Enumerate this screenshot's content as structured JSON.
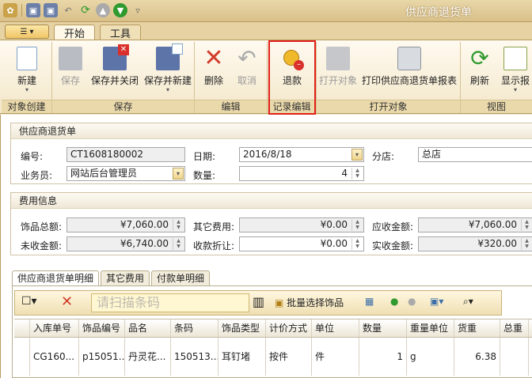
{
  "window": {
    "title": "供应商退货单"
  },
  "ribbon_tabs": [
    {
      "label": "开始"
    },
    {
      "label": "工具"
    }
  ],
  "ribbon": {
    "groups": {
      "create": "对象创建",
      "save": "保存",
      "edit": "编辑",
      "record_edit": "记录编辑",
      "open": "打开对象",
      "view": "视图"
    },
    "buttons": {
      "new": "新建",
      "save": "保存",
      "save_close": "保存并关闭",
      "save_new": "保存并新建",
      "delete": "删除",
      "cancel": "取消",
      "refund": "退款",
      "open_object": "打开对象",
      "print": "打印供应商退货单报表",
      "refresh": "刷新",
      "show_report": "显示报"
    }
  },
  "header_panel": {
    "title": "供应商退货单",
    "number_label": "编号:",
    "number_value": "CT1608180002",
    "date_label": "日期:",
    "date_value": "2016/8/18",
    "branch_label": "分店:",
    "branch_value": "总店",
    "salesman_label": "业务员:",
    "salesman_value": "网站后台管理员",
    "qty_label": "数量:",
    "qty_value": "4"
  },
  "fee_panel": {
    "title": "费用信息",
    "jewelry_total_label": "饰品总额:",
    "jewelry_total_value": "¥7,060.00",
    "other_fee_label": "其它费用:",
    "other_fee_value": "¥0.00",
    "receivable_label": "应收金额:",
    "receivable_value": "¥7,060.00",
    "unreceived_label": "未收金额:",
    "unreceived_value": "¥6,740.00",
    "discount_label": "收款折让:",
    "discount_value": "¥0.00",
    "received_label": "实收金额:",
    "received_value": "¥320.00"
  },
  "detail_tabs": [
    {
      "label": "供应商退货单明细"
    },
    {
      "label": "其它费用"
    },
    {
      "label": "付款单明细"
    }
  ],
  "detail_toolbar": {
    "scan_placeholder": "请扫描条码",
    "batch_select": "批量选择饰品"
  },
  "grid": {
    "columns": [
      "入库单号",
      "饰品编号",
      "品名",
      "条码",
      "饰品类型",
      "计价方式",
      "单位",
      "数量",
      "重量单位",
      "货重",
      "总重"
    ],
    "rows": [
      [
        "CG160...",
        "p15051...",
        "丹灵花...",
        "150513...",
        "耳钉堵",
        "按件",
        "件",
        "1",
        "g",
        "6.38",
        ""
      ]
    ]
  }
}
